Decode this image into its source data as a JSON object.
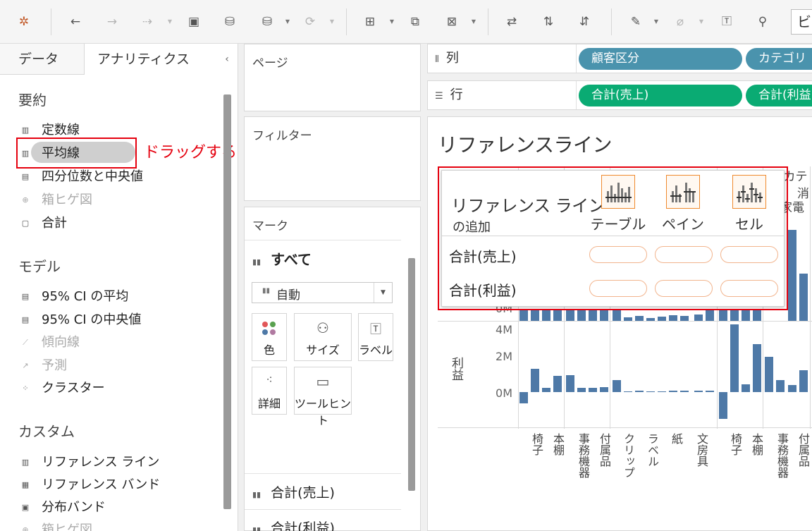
{
  "toolbar": {
    "tableau_icon": "tableau-logo-icon",
    "edge_text": "ビ"
  },
  "left_pane": {
    "tabs": {
      "data": "データ",
      "analytics": "アナリティクス"
    },
    "collapse": "‹",
    "sections": [
      {
        "title": "要約",
        "items": [
          {
            "label": "定数線",
            "icon": "constant-line-icon",
            "dim": false
          },
          {
            "label": "平均線",
            "icon": "average-line-icon",
            "dim": false
          },
          {
            "label": "四分位数と中央値",
            "icon": "quartile-icon",
            "dim": false
          },
          {
            "label": "箱ヒゲ図",
            "icon": "box-plot-icon",
            "dim": true
          },
          {
            "label": "合計",
            "icon": "totals-icon",
            "dim": false
          }
        ]
      },
      {
        "title": "モデル",
        "items": [
          {
            "label": "95% CI の平均",
            "icon": "ci-mean-icon",
            "dim": false
          },
          {
            "label": "95% CI の中央値",
            "icon": "ci-median-icon",
            "dim": false
          },
          {
            "label": "傾向線",
            "icon": "trend-line-icon",
            "dim": true
          },
          {
            "label": "予測",
            "icon": "forecast-icon",
            "dim": true
          },
          {
            "label": "クラスター",
            "icon": "cluster-icon",
            "dim": false
          }
        ]
      },
      {
        "title": "カスタム",
        "items": [
          {
            "label": "リファレンス ライン",
            "icon": "reference-line-icon",
            "dim": false
          },
          {
            "label": "リファレンス バンド",
            "icon": "reference-band-icon",
            "dim": false
          },
          {
            "label": "分布バンド",
            "icon": "distribution-band-icon",
            "dim": false
          },
          {
            "label": "箱ヒゲ図",
            "icon": "box-plot-icon",
            "dim": true
          }
        ]
      }
    ],
    "drag_note": "ドラッグする"
  },
  "pages": {
    "title": "ページ"
  },
  "filters": {
    "title": "フィルター"
  },
  "marks": {
    "title": "マーク",
    "all": "すべて",
    "mark_type": "自動",
    "buttons": [
      {
        "label": "色",
        "icon": "color-icon"
      },
      {
        "label": "サイズ",
        "icon": "size-icon"
      },
      {
        "label": "ラベル",
        "icon": "label-icon"
      },
      {
        "label": "詳細",
        "icon": "detail-icon"
      },
      {
        "label": "ツールヒント",
        "icon": "tooltip-icon"
      }
    ],
    "fields": [
      "合計(売上)",
      "合計(利益)"
    ]
  },
  "shelves": {
    "columns": {
      "label": "列",
      "pills": [
        "顧客区分",
        "カテゴリ"
      ]
    },
    "rows": {
      "label": "行",
      "pills": [
        "合計(売上)",
        "合計(利益)"
      ]
    }
  },
  "view": {
    "title": "リファレンスライン",
    "header_top": "顧客区分 / カテ",
    "header_sub": "消",
    "header_sub2": "家電",
    "axis_sales_zero": "0M",
    "profit_axis": {
      "label": "利益",
      "ticks": [
        "4M",
        "2M",
        "0M"
      ]
    },
    "categories_left": [
      "椅子",
      "本棚",
      "事務機器",
      "付属品",
      "クリップ",
      "ラベル",
      "紙",
      "文房具"
    ],
    "categories_right": [
      "椅子",
      "本棚",
      "事務機器",
      "付属品"
    ]
  },
  "drop_target": {
    "title_line1": "リファレンス ライン",
    "title_line2": "の追加",
    "scopes": [
      "テーブル",
      "ペイン",
      "セル"
    ],
    "rows": [
      "合計(売上)",
      "合計(利益)"
    ]
  },
  "colors": {
    "bar": "#4e79a7",
    "pill_blue": "#4a93ad",
    "pill_green": "#0aab73",
    "highlight": "#e5000e",
    "scope_border": "#ef8a2e"
  }
}
